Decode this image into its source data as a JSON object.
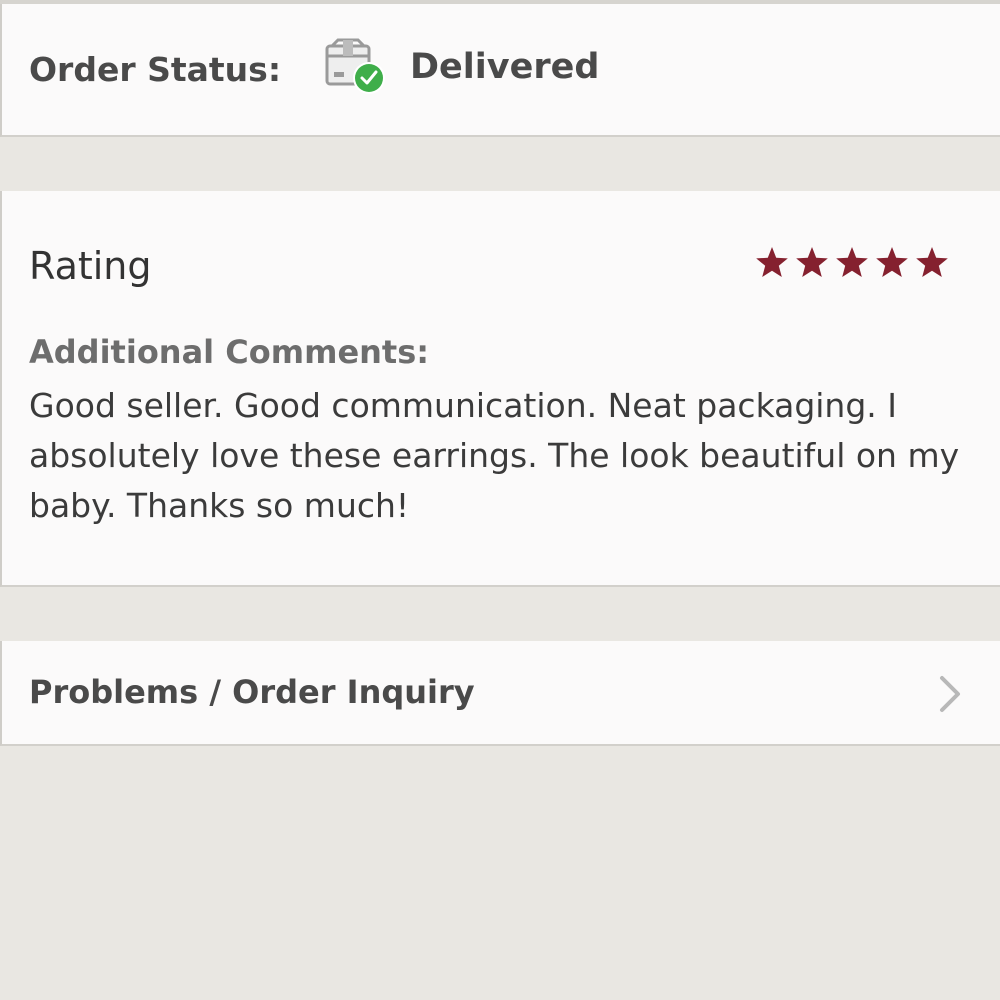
{
  "order_status": {
    "label": "Order Status:",
    "value": "Delivered",
    "icon": "package-delivered-icon"
  },
  "rating": {
    "title": "Rating",
    "stars": 5,
    "max_stars": 5,
    "star_color": "#85212f"
  },
  "comments": {
    "label": "Additional Comments:",
    "text": "Good seller. Good communication. Neat packaging. I absolutely love these earrings. The look beautiful on my baby. Thanks so much!"
  },
  "problems": {
    "label": "Problems / Order Inquiry",
    "icon": "chevron-right-icon"
  },
  "colors": {
    "background": "#e9e7e2",
    "card": "#fbfafa",
    "delivered_check": "#3fae4a"
  }
}
